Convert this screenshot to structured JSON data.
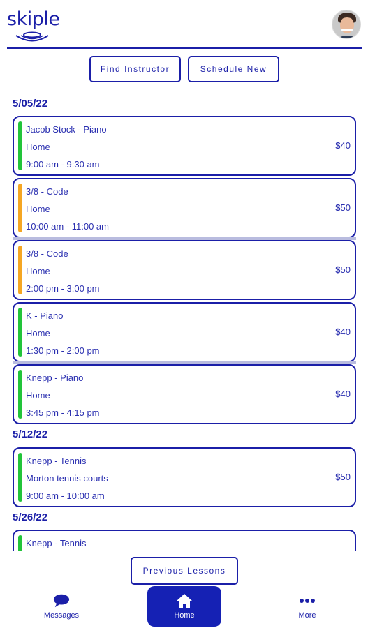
{
  "app": {
    "brand": "skiple"
  },
  "actions": {
    "find_instructor": "Find Instructor",
    "schedule_new": "Schedule New"
  },
  "lessons": [
    {
      "date": "5/05/22",
      "items": [
        {
          "title": "Jacob Stock - Piano",
          "location": "Home",
          "time": "9:00 am - 9:30 am",
          "price": "$40",
          "status_color": "#22c43a"
        },
        {
          "title": "3/8 - Code",
          "location": "Home",
          "time": "10:00 am - 11:00 am",
          "price": "$50",
          "status_color": "#f5a623"
        },
        {
          "title": "3/8 - Code",
          "location": "Home",
          "time": "2:00 pm - 3:00 pm",
          "price": "$50",
          "status_color": "#f5a623"
        },
        {
          "title": " K - Piano",
          "location": "Home",
          "time": "1:30 pm - 2:00 pm",
          "price": "$40",
          "status_color": "#22c43a"
        },
        {
          "title": " Knepp - Piano",
          "location": "Home",
          "time": "3:45 pm - 4:15 pm",
          "price": "$40",
          "status_color": "#22c43a"
        }
      ]
    },
    {
      "date": "5/12/22",
      "items": [
        {
          "title": " Knepp - Tennis",
          "location": "Morton tennis courts",
          "time": "9:00 am - 10:00 am",
          "price": "$50",
          "status_color": "#22c43a"
        }
      ]
    },
    {
      "date": "5/26/22",
      "items": [
        {
          "title": " Knepp - Tennis",
          "location": "",
          "time": "",
          "price": "",
          "status_color": "#22c43a"
        }
      ]
    }
  ],
  "previous_lessons": "Previous Lessons",
  "nav": {
    "messages": {
      "label": "Messages",
      "icon": "chat-bubble-icon"
    },
    "home": {
      "label": "Home",
      "icon": "home-icon"
    },
    "more": {
      "label": "More",
      "icon": "more-dots-icon"
    }
  },
  "colors": {
    "brand": "#1b1fa8",
    "active_nav": "#1521b4",
    "confirmed": "#22c43a",
    "pending": "#f5a623"
  }
}
